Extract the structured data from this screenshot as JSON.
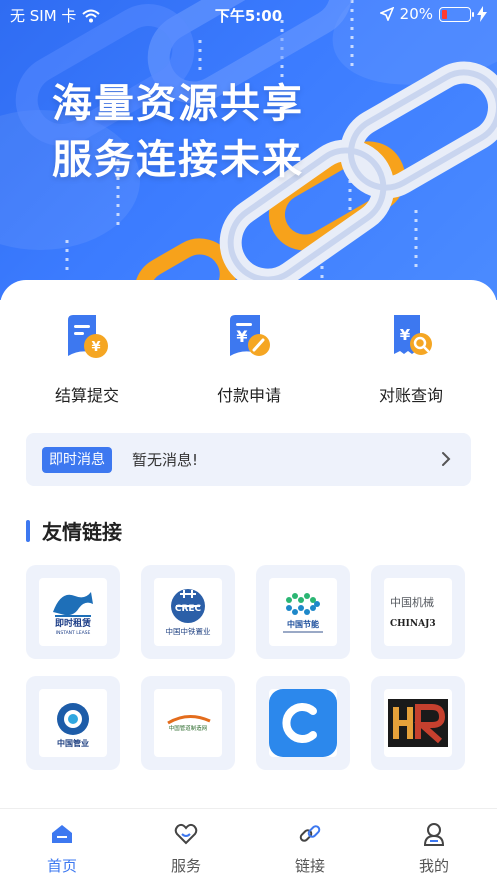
{
  "status_bar": {
    "carrier": "无 SIM 卡",
    "time": "下午5:00",
    "battery": "20%",
    "battery_level": 0.2
  },
  "hero": {
    "line1": "海量资源共享",
    "line2": "服务连接未来"
  },
  "quick_actions": [
    {
      "label": "结算提交",
      "icon": "settlement-document-icon"
    },
    {
      "label": "付款申请",
      "icon": "payment-document-icon"
    },
    {
      "label": "对账查询",
      "icon": "receipt-search-icon"
    }
  ],
  "message_bar": {
    "tag": "即时消息",
    "text": "暂无消息!"
  },
  "links_section": {
    "title": "友情链接"
  },
  "partner_logos": {
    "logo1": "即时租赁",
    "logo1_sub": "INSTANT LEASE",
    "logo2": "中国中铁置业",
    "logo3": "中国节能",
    "logo4_cn": "中国机械",
    "logo4_en": "CHINAJ3",
    "logo5": "中国管业",
    "logo6": "中国管道制造网"
  },
  "colors": {
    "accent": "#3d78f0",
    "orange": "#f5a623",
    "hero_blue": "#3c7cff"
  },
  "tabs": [
    {
      "label": "首页",
      "icon": "home-icon",
      "active": true
    },
    {
      "label": "服务",
      "icon": "heart-service-icon",
      "active": false
    },
    {
      "label": "链接",
      "icon": "link-icon",
      "active": false
    },
    {
      "label": "我的",
      "icon": "user-icon",
      "active": false
    }
  ]
}
